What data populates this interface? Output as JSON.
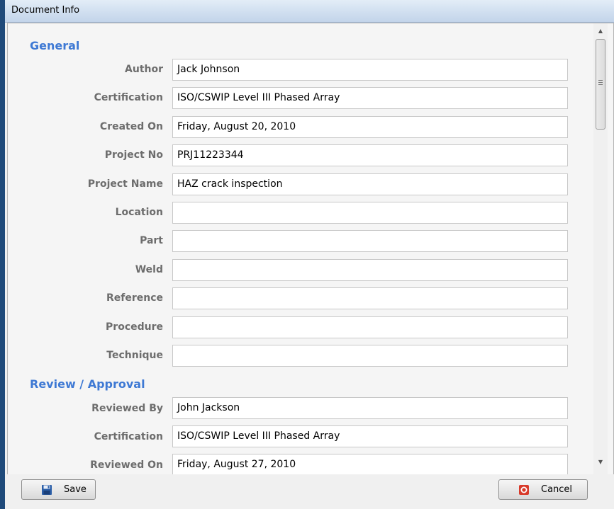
{
  "window": {
    "title": "Document Info"
  },
  "general": {
    "title": "General",
    "fields": [
      {
        "label": "Author",
        "value": "Jack Johnson"
      },
      {
        "label": "Certification",
        "value": "ISO/CSWIP Level III Phased Array"
      },
      {
        "label": "Created On",
        "value": "Friday, August 20, 2010"
      },
      {
        "label": "Project No",
        "value": "PRJ11223344"
      },
      {
        "label": "Project Name",
        "value": "HAZ crack inspection"
      },
      {
        "label": "Location",
        "value": ""
      },
      {
        "label": "Part",
        "value": ""
      },
      {
        "label": "Weld",
        "value": ""
      },
      {
        "label": "Reference",
        "value": ""
      },
      {
        "label": "Procedure",
        "value": ""
      },
      {
        "label": "Technique",
        "value": ""
      }
    ]
  },
  "review": {
    "title": "Review / Approval",
    "fields": [
      {
        "label": "Reviewed By",
        "value": "John Jackson"
      },
      {
        "label": "Certification",
        "value": "ISO/CSWIP Level III Phased Array"
      },
      {
        "label": "Reviewed On",
        "value": "Friday, August 27, 2010"
      }
    ]
  },
  "buttons": {
    "save": "Save",
    "cancel": "Cancel"
  },
  "icons": {
    "save": "floppy-disk-icon",
    "cancel": "red-stop-icon"
  },
  "colors": {
    "section_title": "#3e79d4",
    "label": "#6d6d6d",
    "cancel_icon": "#d83a2a",
    "save_icon": "#2c5fa8"
  }
}
